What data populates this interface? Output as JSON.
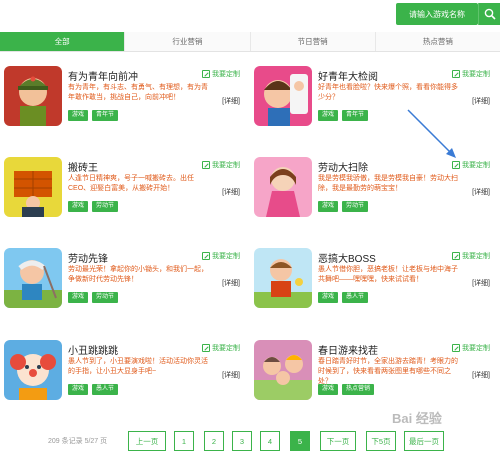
{
  "search": {
    "button_label": "请输入游戏名称"
  },
  "tabs": [
    {
      "label": "全部",
      "active": true
    },
    {
      "label": "行业营销",
      "active": false
    },
    {
      "label": "节日营销",
      "active": false
    },
    {
      "label": "热点营销",
      "active": false
    }
  ],
  "cards": [
    {
      "title": "有为青年向前冲",
      "custom": "我要定制",
      "desc": "有为青年，有斗志、有勇气、有理想，有为青年敢作敢当，挑战自己，向前冲吧！",
      "detail": "[详细]",
      "tags": [
        "游戏",
        "青年节"
      ]
    },
    {
      "title": "好青年大检阅",
      "custom": "我要定制",
      "desc": "好青年也看脸啦？快来爆个照，看看你能得多少分？",
      "detail": "[详细]",
      "tags": [
        "游戏",
        "青年节"
      ]
    },
    {
      "title": "搬砖王",
      "custom": "我要定制",
      "desc": "人逢节日精神爽，号子一喊搬砖去。出任CEO、迎娶白富美，从搬砖开始！",
      "detail": "[详细]",
      "tags": [
        "游戏",
        "劳动节"
      ]
    },
    {
      "title": "劳动大扫除",
      "custom": "我要定制",
      "desc": "我是劳模我骄傲，我是劳模我自豪！劳动大扫除，我是最勤劳的萌宝宝！",
      "detail": "[详细]",
      "tags": [
        "游戏",
        "劳动节"
      ]
    },
    {
      "title": "劳动先锋",
      "custom": "我要定制",
      "desc": "劳动最光荣！拿起你的小锄头，和我们一起，争做新时代劳动先锋！",
      "detail": "[详细]",
      "tags": [
        "游戏",
        "劳动节"
      ]
    },
    {
      "title": "恶搞大BOSS",
      "custom": "我要定制",
      "desc": "愚人节借你胆，恶搞老板！让老板与地中海子共舞吧——嘿嘿嘿，快来试试看！",
      "detail": "[详细]",
      "tags": [
        "游戏",
        "愚人节"
      ]
    },
    {
      "title": "小丑跳跳跳",
      "custom": "我要定制",
      "desc": "愚人节到了，小丑要演戏啦！活动活动你灵活的手指，让小丑大显身手吧~",
      "detail": "[详细]",
      "tags": [
        "游戏",
        "愚人节"
      ]
    },
    {
      "title": "春日游来找茬",
      "custom": "我要定制",
      "desc": "春日踏青好时节，全家出游去踏青！考眼力的时候到了，快来看看两张图里有哪些不同之处？",
      "detail": "[详细]",
      "tags": [
        "游戏",
        "热点营销"
      ]
    }
  ],
  "pager": {
    "info": "209 条记录 5/27 页",
    "prev": "上一页",
    "pages": [
      "1",
      "2",
      "3",
      "4",
      "5"
    ],
    "current": "5",
    "next": "下一页",
    "next5": "下5页",
    "last": "最后一页"
  },
  "colors": {
    "accent": "#3bb34a",
    "desc": "#e05a1a"
  },
  "watermark": "Bai 经验"
}
